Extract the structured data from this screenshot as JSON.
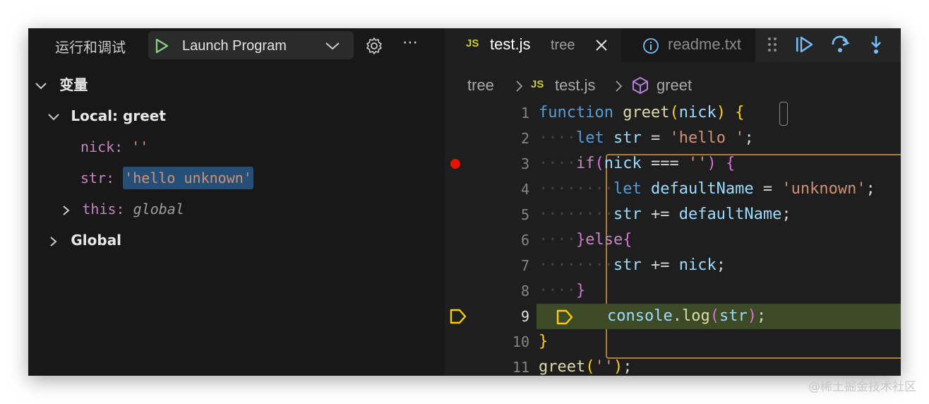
{
  "debug_panel": {
    "title": "运行和调试",
    "launch_config": "Launch Program",
    "variables_section": "变量",
    "scopes": [
      {
        "label": "Local: greet",
        "variables": [
          {
            "name": "nick",
            "value": "''"
          },
          {
            "name": "str",
            "value": "'hello unknown'"
          },
          {
            "name": "this",
            "value": "global"
          }
        ]
      },
      {
        "label": "Global"
      }
    ]
  },
  "editor": {
    "tabs": [
      {
        "badge": "JS",
        "name": "test.js",
        "dir": "tree",
        "active": true
      },
      {
        "name": "readme.txt",
        "active": false
      }
    ],
    "breadcrumb": {
      "folder": "tree",
      "badge": "JS",
      "file": "test.js",
      "symbol": "greet"
    },
    "line_numbers": [
      "1",
      "2",
      "3",
      "4",
      "5",
      "6",
      "7",
      "8",
      "9",
      "10",
      "11"
    ],
    "breakpoint_line": 3,
    "current_line": 9
  },
  "colors": {
    "breakpoint": "#e51400",
    "current_line_highlight": "#3d4a26",
    "debug_arrow": "#ffcc00",
    "play": "#89d185",
    "toolbar_icons": "#75beff"
  },
  "watermark": "@稀土掘金技术社区"
}
